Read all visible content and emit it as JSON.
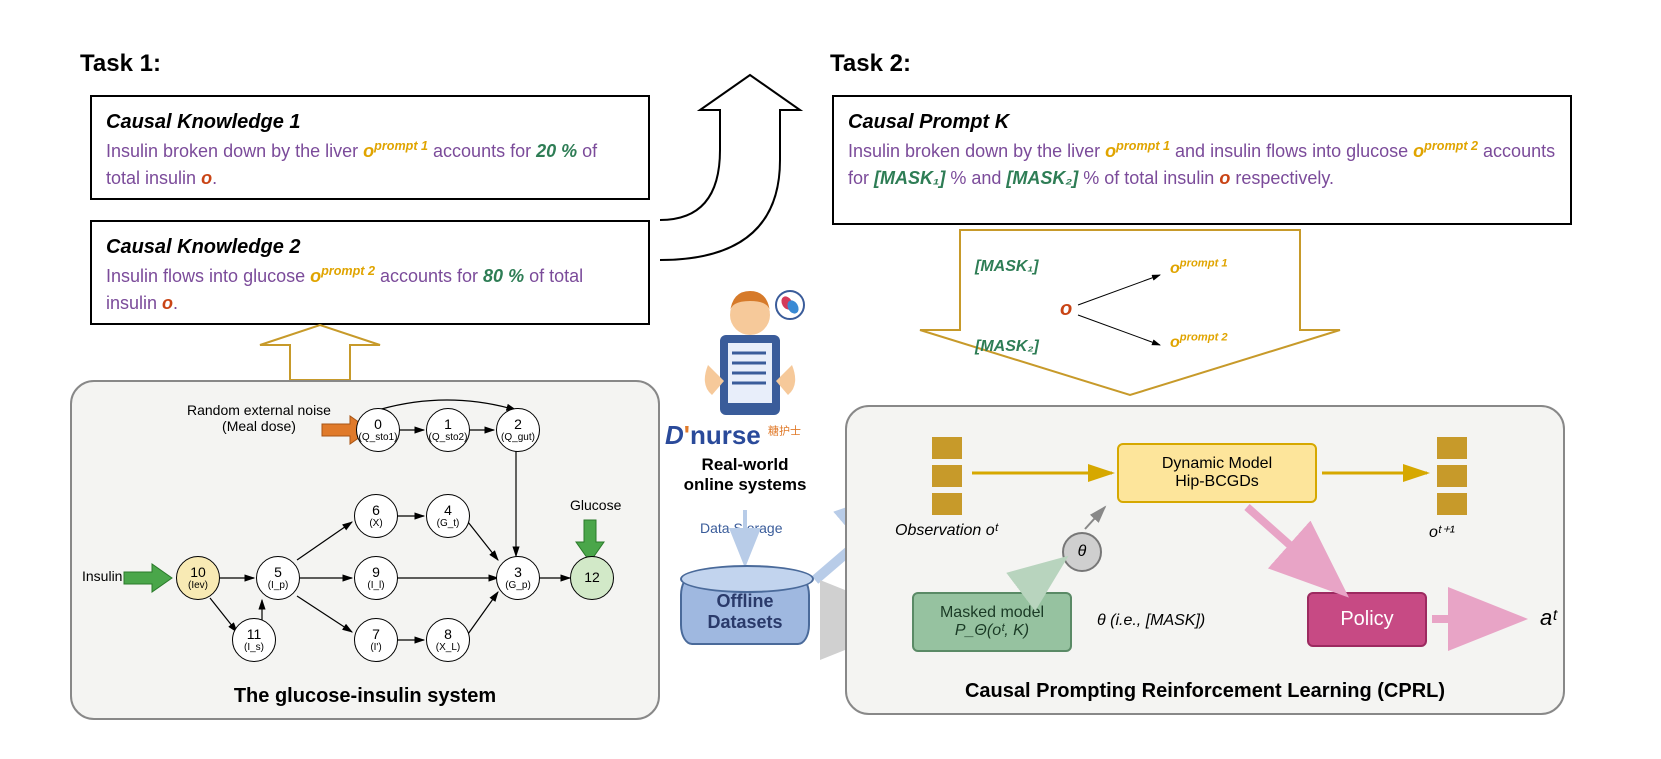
{
  "task1": {
    "label": "Task 1:",
    "ck1": {
      "title": "Causal Knowledge 1",
      "text_pre": "Insulin broken down by the liver ",
      "oprompt": "o",
      "oprompt_sup": "prompt 1",
      "text_mid": " accounts for ",
      "percent": "20 %",
      "text_post": " of total insulin ",
      "ovar": "o",
      "text_end": "."
    },
    "ck2": {
      "title": "Causal Knowledge 2",
      "text_pre": "Insulin flows into glucose ",
      "oprompt": "o",
      "oprompt_sup": "prompt 2",
      "text_mid": " accounts for ",
      "percent": "80 %",
      "text_post": " of total insulin ",
      "ovar": "o",
      "text_end": "."
    },
    "graph": {
      "noise_label": "Random external noise\n(Meal dose)",
      "insulin_label": "Insulin",
      "glucose_label": "Glucose",
      "nodes": {
        "n0": {
          "num": "0",
          "sub": "(Q_sto1)"
        },
        "n1": {
          "num": "1",
          "sub": "(Q_sto2)"
        },
        "n2": {
          "num": "2",
          "sub": "(Q_gut)"
        },
        "n3": {
          "num": "3",
          "sub": "(G_p)"
        },
        "n4": {
          "num": "4",
          "sub": "(G_t)"
        },
        "n5": {
          "num": "5",
          "sub": "(I_p)"
        },
        "n6": {
          "num": "6",
          "sub": "(X)"
        },
        "n7": {
          "num": "7",
          "sub": "(I')"
        },
        "n8": {
          "num": "8",
          "sub": "(X_L)"
        },
        "n9": {
          "num": "9",
          "sub": "(I_l)"
        },
        "n10": {
          "num": "10",
          "sub": "(Iev)"
        },
        "n11": {
          "num": "11",
          "sub": "(I_s)"
        },
        "n12": {
          "num": "12",
          "sub": ""
        }
      },
      "caption": "The glucose-insulin system"
    }
  },
  "mid": {
    "dnurse_logo": "D'nurse",
    "dnurse_sub": "糖护士",
    "real_world": "Real-world online systems",
    "data_storage": "Data Storage",
    "offline": "Offline Datasets"
  },
  "task2": {
    "label": "Task 2:",
    "prompt": {
      "title": "Causal Prompt K",
      "text_pre": "Insulin broken down by the liver ",
      "op1": "o",
      "op1_sup": "prompt 1",
      "text_mid1": " and insulin flows into glucose ",
      "op2": "o",
      "op2_sup": "prompt 2",
      "text_mid2": " accounts for ",
      "m1": "[MASK₁]",
      "text_pc1": " % and ",
      "m2": "[MASK₂]",
      "text_pc2": " % of total insulin ",
      "ovar": "o",
      "text_end": " respectively."
    },
    "causal_arrow": {
      "mask1": "[MASK₁]",
      "mask2": "[MASK₂]",
      "ovar": "o",
      "op1": "o",
      "op1_sup": "prompt 1",
      "op2": "o",
      "op2_sup": "prompt 2"
    },
    "rl": {
      "obs_label": "Observation oᵗ",
      "dyn_model_l1": "Dynamic Model",
      "dyn_model_l2": "Hip-BCGDs",
      "ot1": "oᵗ⁺¹",
      "theta": "θ",
      "masked_l1": "Masked model",
      "masked_l2": "P_Θ(oᵗ, K)",
      "theta_mask": "θ (i.e., [MASK])",
      "policy": "Policy",
      "action": "aᵗ",
      "caption": "Causal Prompting Reinforcement Learning (CPRL)"
    }
  }
}
